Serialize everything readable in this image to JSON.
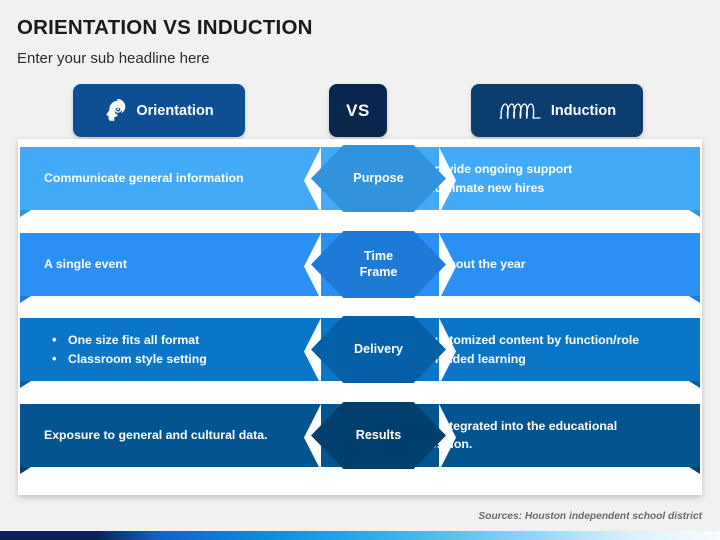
{
  "header": {
    "title": "ORIENTATION VS INDUCTION",
    "subtitle": "Enter your sub headline here"
  },
  "badges": {
    "left": {
      "label": "Orientation",
      "icon": "head-compass-icon",
      "color": "#0d4f92"
    },
    "middle": {
      "label": "VS",
      "color": "#09274d"
    },
    "right": {
      "label": "Induction",
      "icon": "inductor-coil-icon",
      "color": "#0a3d6e"
    }
  },
  "comparison": {
    "rows": [
      {
        "center_label": "Purpose",
        "bar_color": "#42aaf8",
        "hex_color": "#3193de",
        "left": {
          "bulleted": false,
          "items": [
            "Communicate general information"
          ]
        },
        "right": {
          "bulleted": true,
          "items": [
            "Provide ongoing support",
            "Acclimate new hires"
          ]
        }
      },
      {
        "center_label": "Time\nFrame",
        "center_label_line1": "Time",
        "center_label_line2": "Frame",
        "bar_color": "#2a90f5",
        "hex_color": "#1d7ad6",
        "left": {
          "bulleted": false,
          "items": [
            "A single event"
          ]
        },
        "right": {
          "bulleted": false,
          "items": [
            "Throughout the year"
          ]
        }
      },
      {
        "center_label": "Delivery",
        "bar_color": "#0b76c8",
        "hex_color": "#045fa6",
        "left": {
          "bulleted": true,
          "items": [
            "One size fits all format",
            "Classroom style setting"
          ]
        },
        "right": {
          "bulleted": true,
          "items": [
            "Customized content by function/role",
            "Blended learning"
          ]
        }
      },
      {
        "center_label": "Results",
        "bar_color": "#04558f",
        "hex_color": "#013f6e",
        "left": {
          "bulleted": false,
          "items": [
            "Exposure to general and cultural data."
          ]
        },
        "right": {
          "bulleted": false,
          "items": [
            "Fully integrated into the educational profession."
          ]
        }
      }
    ]
  },
  "footer": {
    "source": "Sources: Houston independent school district"
  }
}
